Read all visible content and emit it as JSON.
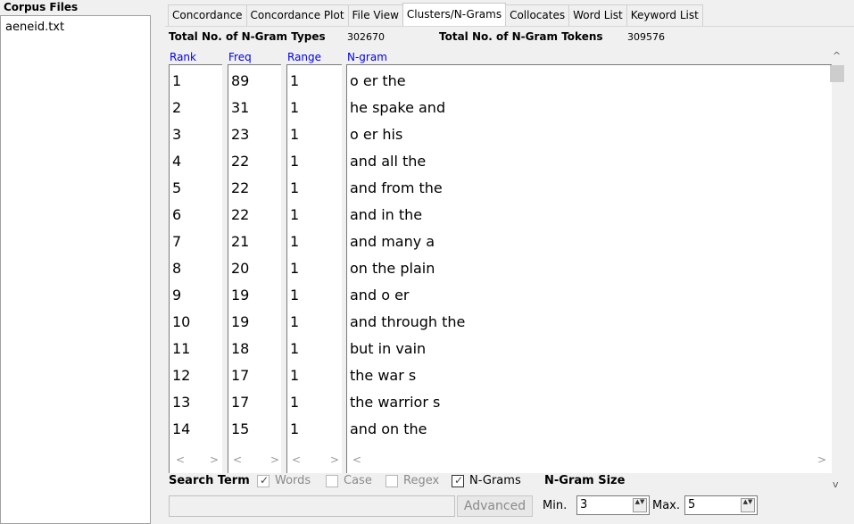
{
  "corpus": {
    "title": "Corpus Files",
    "files": [
      "aeneid.txt"
    ]
  },
  "tabs": [
    {
      "label": "Concordance",
      "active": false
    },
    {
      "label": "Concordance Plot",
      "active": false
    },
    {
      "label": "File View",
      "active": false
    },
    {
      "label": "Clusters/N-Grams",
      "active": true
    },
    {
      "label": "Collocates",
      "active": false
    },
    {
      "label": "Word List",
      "active": false
    },
    {
      "label": "Keyword List",
      "active": false
    }
  ],
  "totals": {
    "types_label": "Total No. of N-Gram Types",
    "types_value": "302670",
    "tokens_label": "Total No. of N-Gram Tokens",
    "tokens_value": "309576"
  },
  "columns": {
    "rank": "Rank",
    "freq": "Freq",
    "range": "Range",
    "ngram": "N-gram"
  },
  "rows": [
    {
      "rank": "1",
      "freq": "89",
      "range": "1",
      "ngram": "o er the"
    },
    {
      "rank": "2",
      "freq": "31",
      "range": "1",
      "ngram": "he spake and"
    },
    {
      "rank": "3",
      "freq": "23",
      "range": "1",
      "ngram": "o er his"
    },
    {
      "rank": "4",
      "freq": "22",
      "range": "1",
      "ngram": "and all the"
    },
    {
      "rank": "5",
      "freq": "22",
      "range": "1",
      "ngram": "and from the"
    },
    {
      "rank": "6",
      "freq": "22",
      "range": "1",
      "ngram": "and in the"
    },
    {
      "rank": "7",
      "freq": "21",
      "range": "1",
      "ngram": "and many a"
    },
    {
      "rank": "8",
      "freq": "20",
      "range": "1",
      "ngram": "on the plain"
    },
    {
      "rank": "9",
      "freq": "19",
      "range": "1",
      "ngram": "and o er"
    },
    {
      "rank": "10",
      "freq": "19",
      "range": "1",
      "ngram": "and through the"
    },
    {
      "rank": "11",
      "freq": "18",
      "range": "1",
      "ngram": "but in vain"
    },
    {
      "rank": "12",
      "freq": "17",
      "range": "1",
      "ngram": "the war s"
    },
    {
      "rank": "13",
      "freq": "17",
      "range": "1",
      "ngram": "the warrior s"
    },
    {
      "rank": "14",
      "freq": "15",
      "range": "1",
      "ngram": "and on the"
    }
  ],
  "search": {
    "label": "Search Term",
    "words": {
      "label": "Words",
      "checked": true,
      "enabled": false
    },
    "case": {
      "label": "Case",
      "checked": false,
      "enabled": false
    },
    "regex": {
      "label": "Regex",
      "checked": false,
      "enabled": false
    },
    "ngrams": {
      "label": "N-Grams",
      "checked": true,
      "enabled": true
    },
    "ngram_size_label": "N-Gram Size",
    "input_value": "",
    "advanced_label": "Advanced",
    "min_label": "Min.",
    "min_value": "3",
    "max_label": "Max.",
    "max_value": "5"
  },
  "glyphs": {
    "up": "^",
    "down": "v",
    "left": "<",
    "right": ">",
    "check": "✓",
    "spin": "▲▼"
  },
  "icons": [
    "scroll-up-icon",
    "scroll-down-icon",
    "scroll-left-icon",
    "scroll-right-icon",
    "checkmark-icon",
    "spinner-arrows-icon"
  ]
}
